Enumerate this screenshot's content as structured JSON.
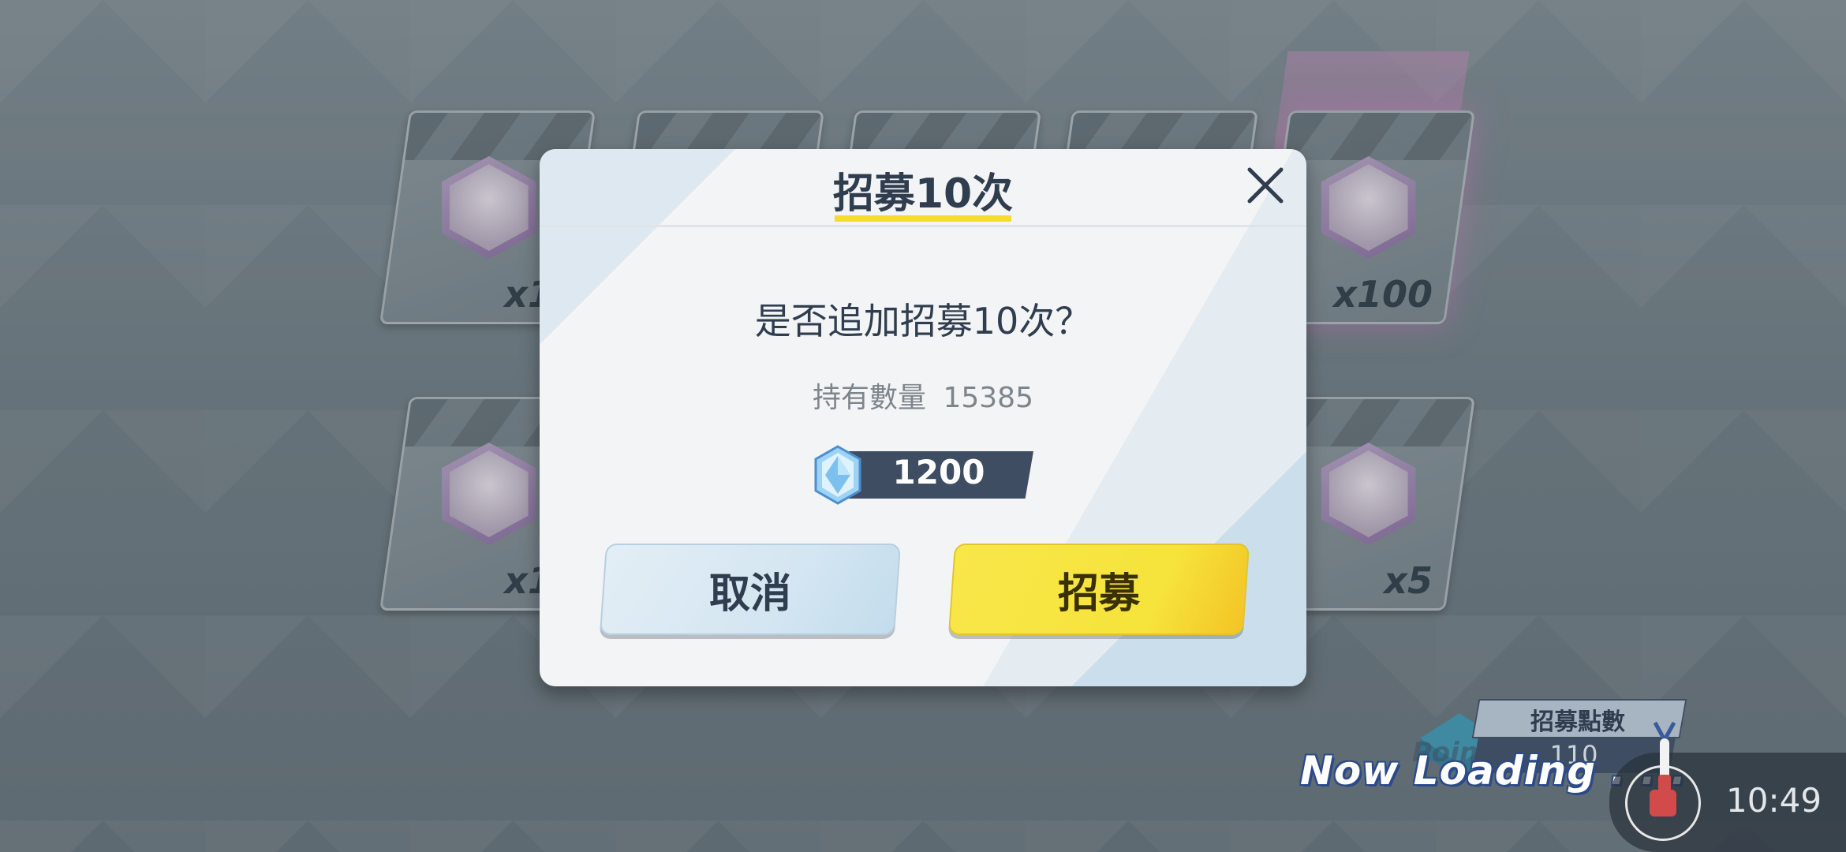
{
  "background": {
    "cards_row1": [
      "x1",
      "",
      "",
      "",
      "x100"
    ],
    "cards_row2": [
      "x1",
      "x5"
    ]
  },
  "dialog": {
    "title": "招募10次",
    "question": "是否追加招募10次？",
    "owned_label": "持有數量",
    "owned_value": "15385",
    "cost": "1200",
    "cancel_label": "取消",
    "recruit_label": "招募"
  },
  "hud": {
    "point_label": "招募點數",
    "point_word": "Point",
    "point_value": "110",
    "loading_text": "Now Loading . . .",
    "clock": "10:49"
  },
  "colors": {
    "accent_yellow": "#f6e33b",
    "title_text": "#2f3d4f",
    "cost_bar": "#3e4d61",
    "loading_outline": "#2c4a8a"
  },
  "icons": [
    "close-icon",
    "crystal-gem-icon",
    "point-envelope-icon",
    "record-icon",
    "bell-icon"
  ]
}
